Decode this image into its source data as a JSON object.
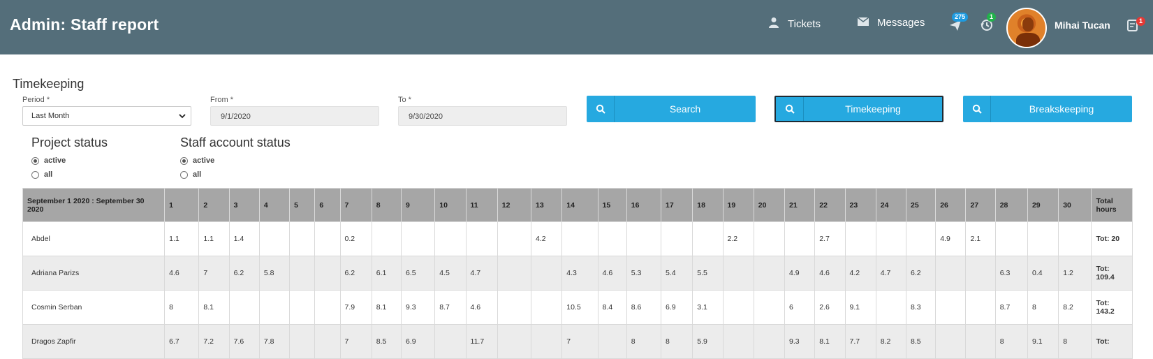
{
  "header": {
    "title": "Admin: Staff report",
    "nav": {
      "tickets_label": "Tickets",
      "messages_label": "Messages"
    },
    "badges": {
      "sent": "275",
      "history": "1",
      "notifications": "1"
    },
    "user_name": "Mihai Tucan",
    "colors": {
      "bar": "#546e7a",
      "accent": "#26a9e0"
    }
  },
  "filters": {
    "section_title": "Timekeeping",
    "period": {
      "label": "Period *",
      "value": "Last Month"
    },
    "from": {
      "label": "From *",
      "value": "9/1/2020"
    },
    "to": {
      "label": "To *",
      "value": "9/30/2020"
    },
    "buttons": {
      "search": "Search",
      "timekeeping": "Timekeeping",
      "breakskeeping": "Breakskeeping"
    },
    "project_status": {
      "title": "Project status",
      "options": [
        "active",
        "all"
      ],
      "selected": "active"
    },
    "staff_account_status": {
      "title": "Staff account status",
      "options": [
        "active",
        "all"
      ],
      "selected": "active"
    }
  },
  "table": {
    "period_header": "September 1 2020 : September 30 2020",
    "days": [
      "1",
      "2",
      "3",
      "4",
      "5",
      "6",
      "7",
      "8",
      "9",
      "10",
      "11",
      "12",
      "13",
      "14",
      "15",
      "16",
      "17",
      "18",
      "19",
      "20",
      "21",
      "22",
      "23",
      "24",
      "25",
      "26",
      "27",
      "28",
      "29",
      "30"
    ],
    "total_header": "Total hours",
    "rows": [
      {
        "name": "Abdel",
        "hours": [
          "1.1",
          "1.1",
          "1.4",
          "",
          "",
          "",
          "0.2",
          "",
          "",
          "",
          "",
          "",
          "4.2",
          "",
          "",
          "",
          "",
          "",
          "2.2",
          "",
          "",
          "2.7",
          "",
          "",
          "",
          "4.9",
          "2.1",
          "",
          "",
          ""
        ],
        "total": "Tot: 20"
      },
      {
        "name": "Adriana Parizs",
        "hours": [
          "4.6",
          "7",
          "6.2",
          "5.8",
          "",
          "",
          "6.2",
          "6.1",
          "6.5",
          "4.5",
          "4.7",
          "",
          "",
          "4.3",
          "4.6",
          "5.3",
          "5.4",
          "5.5",
          "",
          "",
          "4.9",
          "4.6",
          "4.2",
          "4.7",
          "6.2",
          "",
          "",
          "6.3",
          "0.4",
          "1.2"
        ],
        "total": "Tot: 109.4"
      },
      {
        "name": "Cosmin Serban",
        "hours": [
          "8",
          "8.1",
          "",
          "",
          "",
          "",
          "7.9",
          "8.1",
          "9.3",
          "8.7",
          "4.6",
          "",
          "",
          "10.5",
          "8.4",
          "8.6",
          "6.9",
          "3.1",
          "",
          "",
          "6",
          "2.6",
          "9.1",
          "",
          "8.3",
          "",
          "",
          "8.7",
          "8",
          "8.2"
        ],
        "total": "Tot: 143.2"
      },
      {
        "name": "Dragos Zapfir",
        "hours": [
          "6.7",
          "7.2",
          "7.6",
          "7.8",
          "",
          "",
          "7",
          "8.5",
          "6.9",
          "",
          "11.7",
          "",
          "",
          "7",
          "",
          "8",
          "8",
          "5.9",
          "",
          "",
          "9.3",
          "8.1",
          "7.7",
          "8.2",
          "8.5",
          "",
          "",
          "8",
          "9.1",
          "8"
        ],
        "total": "Tot:"
      }
    ]
  }
}
